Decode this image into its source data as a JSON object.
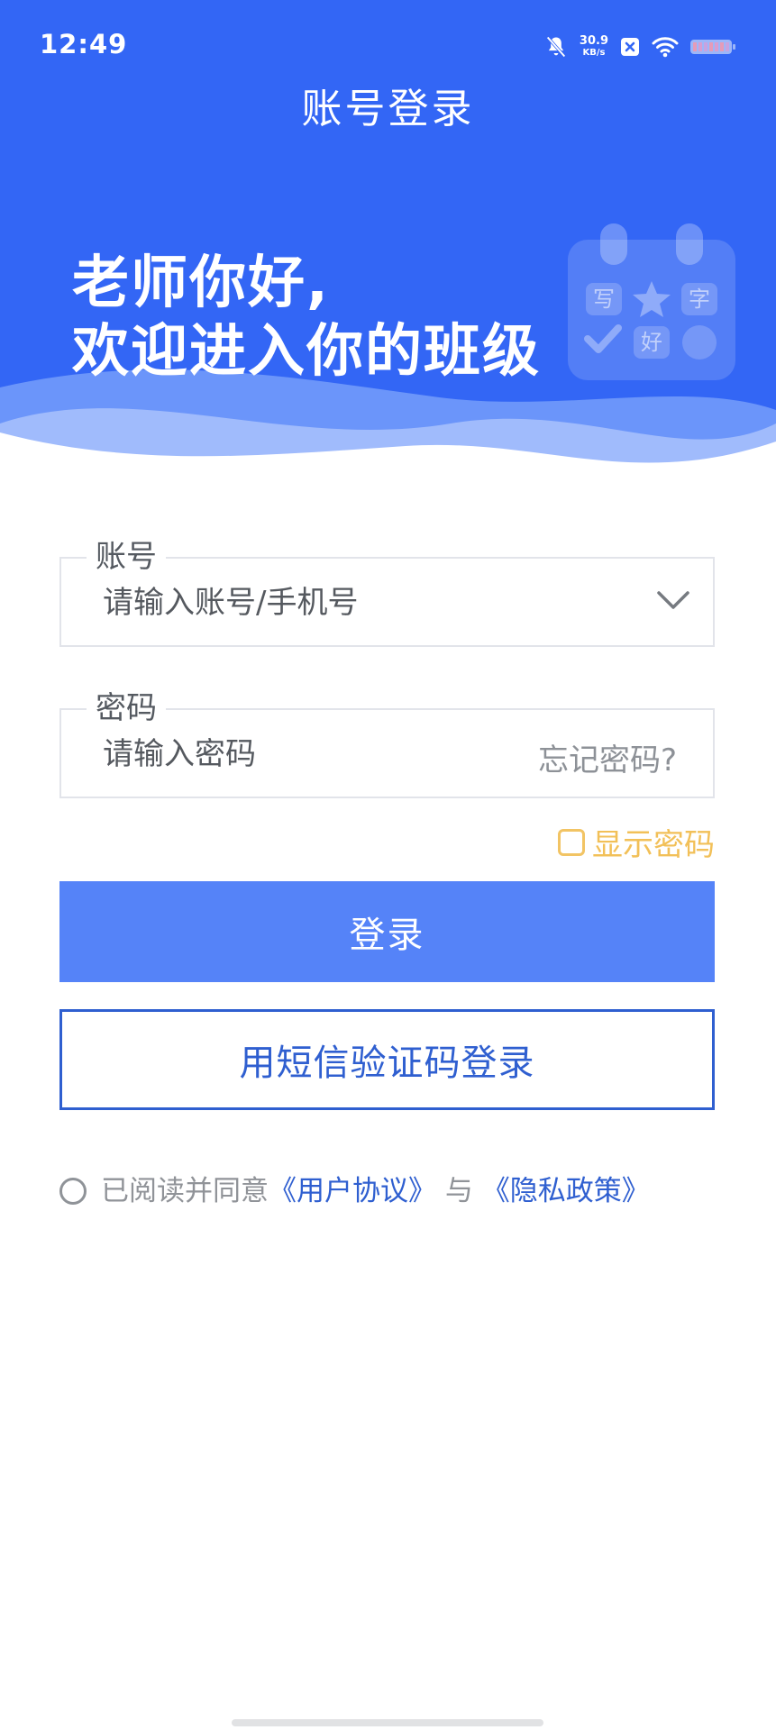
{
  "status_bar": {
    "time": "12:49",
    "net_speed_value": "30.9",
    "net_speed_unit": "KB/s",
    "icons": [
      "bell-mute-icon",
      "close-box-icon",
      "wifi-icon",
      "battery-icon"
    ]
  },
  "header": {
    "title": "账号登录"
  },
  "hero": {
    "greeting_line1": "老师你好,",
    "greeting_line2": "欢迎进入你的班级",
    "calendar_chars": [
      "写",
      "字",
      "好"
    ]
  },
  "account": {
    "label": "账号",
    "placeholder": "请输入账号/手机号"
  },
  "password": {
    "label": "密码",
    "placeholder": "请输入密码",
    "forgot_label": "忘记密码?",
    "show_label": "显示密码"
  },
  "buttons": {
    "login_label": "登录",
    "sms_login_label": "用短信验证码登录"
  },
  "agreement": {
    "prefix": "已阅读并同意",
    "user_agreement": "《用户协议》",
    "connector": " 与 ",
    "privacy_policy": "《隐私政策》"
  },
  "colors": {
    "brand_blue": "#3366f5",
    "button_blue": "#5583f8",
    "link_blue": "#2f5fd0",
    "warning_yellow": "#f2c058"
  }
}
